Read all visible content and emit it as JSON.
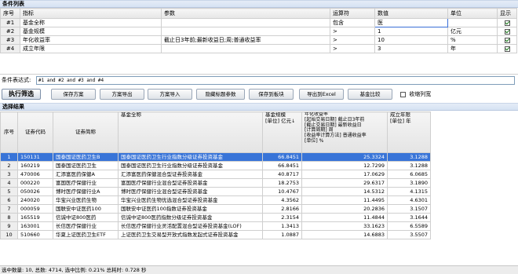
{
  "condition_panel": {
    "title": "条件列表",
    "columns": [
      "序号",
      "指标",
      "参数",
      "运算符",
      "数值",
      "单位",
      "显示"
    ],
    "rows": [
      {
        "no": "#1",
        "indicator": "基金全称",
        "param": "",
        "op": "包含",
        "value": "医",
        "unit": "",
        "show": true
      },
      {
        "no": "#2",
        "indicator": "基金规模",
        "param": "",
        "op": ">",
        "value": "1",
        "unit": "亿元",
        "show": true
      },
      {
        "no": "#3",
        "indicator": "年化收益率",
        "param": "截止日3年前;最新收益日;周;普通收益率",
        "op": ">",
        "value": "10",
        "unit": "%",
        "show": true
      },
      {
        "no": "#4",
        "indicator": "成立年限",
        "param": "",
        "op": ">",
        "value": "3",
        "unit": "年",
        "show": true
      }
    ]
  },
  "expression": {
    "label": "条件表达式:",
    "value": "#1 and #2 and #3 and #4"
  },
  "toolbar": {
    "execute": "执行筛选",
    "save_plan": "保存方案",
    "export_plan": "方案导出",
    "import_plan": "方案导入",
    "hide_params": "隐藏标题参数",
    "save_to_board": "保存到板块",
    "export_excel": "导出到Excel",
    "compare": "基金比较",
    "collapse": "收缩列宽"
  },
  "results": {
    "title": "选择结果",
    "headers": {
      "no": "序号",
      "code": "证券代码",
      "short": "证券简称",
      "full": "基金全称",
      "scale": "基金规模\n[单位] 亿元",
      "return": "年化收益率\n[起始交易日期] 截止日3年前\n[截止交易日期] 最新收益日\n[计算周期] 周\n[收益率计算方法] 普通收益率\n[单位] %",
      "years": "成立年限\n[单位] 年"
    },
    "rows": [
      {
        "no": "1",
        "code": "150131",
        "short": "国泰国证医药卫生B",
        "full": "国泰国证医药卫生行业指数分级证券投资基金",
        "scale": "66.8451",
        "ret": "25.3324",
        "years": "3.1288"
      },
      {
        "no": "2",
        "code": "160219",
        "short": "国泰国证医药卫生",
        "full": "国泰国证医药卫生行业指数分级证券投资基金",
        "scale": "66.8451",
        "ret": "12.7299",
        "years": "3.1288"
      },
      {
        "no": "3",
        "code": "470006",
        "short": "汇添富医药保健A",
        "full": "汇添富医药保健混合型证券投资基金",
        "scale": "40.8717",
        "ret": "17.0629",
        "years": "6.0685"
      },
      {
        "no": "4",
        "code": "000220",
        "short": "富国医疗保健行业",
        "full": "富国医疗保健行业混合型证券投资基金",
        "scale": "18.2753",
        "ret": "29.6317",
        "years": "3.1890"
      },
      {
        "no": "5",
        "code": "050026",
        "short": "博时医疗保健行业A",
        "full": "博时医疗保健行业混合型证券投资基金",
        "scale": "10.4767",
        "ret": "14.5312",
        "years": "4.1315"
      },
      {
        "no": "6",
        "code": "240020",
        "short": "华宝兴业医药生物",
        "full": "华宝兴业医药生物优选混合型证券投资基金",
        "scale": "4.3562",
        "ret": "11.4495",
        "years": "4.6301"
      },
      {
        "no": "7",
        "code": "000059",
        "short": "国联安中证医药100",
        "full": "国联安中证医药100指数证券投资基金",
        "scale": "2.8166",
        "ret": "20.2836",
        "years": "3.1507"
      },
      {
        "no": "8",
        "code": "165519",
        "short": "信诚中证800医药",
        "full": "信诚中证800医药指数分级证券投资基金",
        "scale": "2.3154",
        "ret": "11.4844",
        "years": "3.1644"
      },
      {
        "no": "9",
        "code": "163001",
        "short": "长信医疗保健行业",
        "full": "长信医疗保健行业灵活配置混合型证券投资基金(LOF)",
        "scale": "1.3413",
        "ret": "33.1623",
        "years": "6.5589"
      },
      {
        "no": "10",
        "code": "510660",
        "short": "华夏上证医药卫生ETF",
        "full": "上证医药卫生交易型开放式指数发起式证券投资基金",
        "scale": "1.0887",
        "ret": "14.6883",
        "years": "3.5507"
      }
    ]
  },
  "status": "选中数量: 10, 总数: 4714, 选中比例: 0.21% 总耗时: 0.728 秒"
}
